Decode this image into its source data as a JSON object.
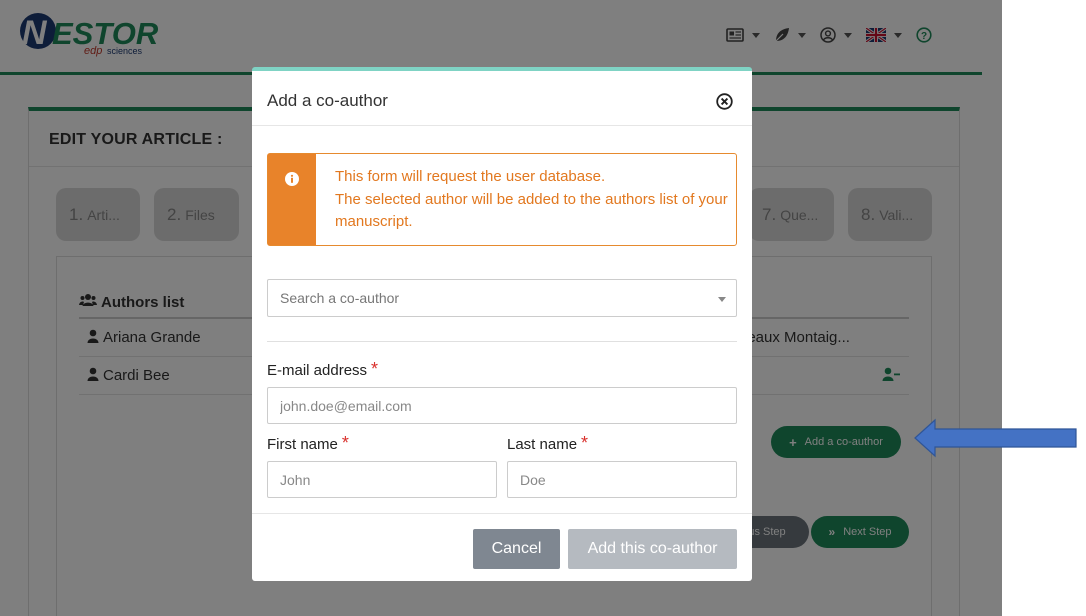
{
  "colors": {
    "brand_green": "#1f8a5b",
    "modal_accent": "#7fd3c4",
    "alert_orange": "#e8832a",
    "required_red": "#d9302c",
    "annotation_blue": "#4472c4"
  },
  "brand": {
    "logo_text": "NESTOR",
    "logo_subtext": "edp sciences"
  },
  "nav": {
    "icons": [
      "newspaper-icon",
      "leaf-icon",
      "user-circle-icon",
      "uk-flag-icon",
      "help-icon"
    ]
  },
  "page": {
    "title": "EDIT YOUR ARTICLE :",
    "steps": [
      {
        "num": "1.",
        "label": "Arti..."
      },
      {
        "num": "2.",
        "label": "Files"
      },
      {
        "num": "7.",
        "label": "Que..."
      },
      {
        "num": "8.",
        "label": "Vali..."
      }
    ],
    "authors_list_label": "Authors list",
    "authors": [
      {
        "name": "Ariana Grande",
        "affiliation": "rdeaux Montaig..."
      },
      {
        "name": "Cardi Bee",
        "affiliation": ""
      }
    ],
    "add_coauthor_label": "Add a co-author",
    "prev_step_label": "us Step",
    "next_step_label": "Next Step"
  },
  "modal": {
    "title": "Add a co-author",
    "alert_line1": "This form will request the user database.",
    "alert_line2": "The selected author will be added to the authors list of your manuscript.",
    "search_placeholder": "Search a co-author",
    "email_label": "E-mail address",
    "email_placeholder": "john.doe@email.com",
    "first_name_label": "First name",
    "first_name_placeholder": "John",
    "last_name_label": "Last name",
    "last_name_placeholder": "Doe",
    "required_mark": "*",
    "cancel_label": "Cancel",
    "submit_label": "Add this co-author"
  }
}
